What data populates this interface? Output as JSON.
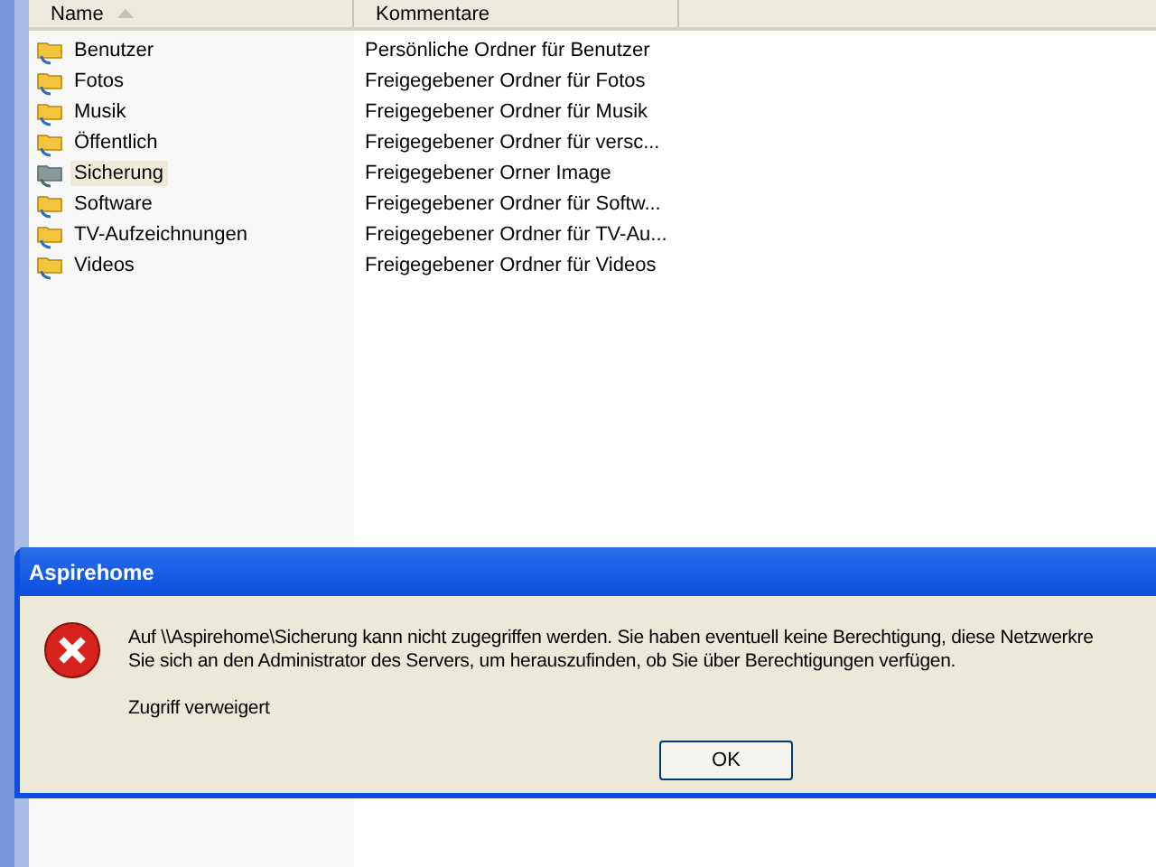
{
  "columns": [
    {
      "label": "Name",
      "sorted": true
    },
    {
      "label": "Kommentare",
      "sorted": false
    }
  ],
  "rows": [
    {
      "name": "Benutzer",
      "comment": "Persönliche Ordner für Benutzer",
      "selected": false,
      "dimmed": false
    },
    {
      "name": "Fotos",
      "comment": "Freigegebener Ordner für Fotos",
      "selected": false,
      "dimmed": false
    },
    {
      "name": "Musik",
      "comment": "Freigegebener Ordner für Musik",
      "selected": false,
      "dimmed": false
    },
    {
      "name": "Öffentlich",
      "comment": "Freigegebener Ordner für versc...",
      "selected": false,
      "dimmed": false
    },
    {
      "name": "Sicherung",
      "comment": "Freigegebener Orner Image",
      "selected": true,
      "dimmed": true
    },
    {
      "name": "Software",
      "comment": "Freigegebener Ordner für Softw...",
      "selected": false,
      "dimmed": false
    },
    {
      "name": "TV-Aufzeichnungen",
      "comment": "Freigegebener Ordner für TV-Au...",
      "selected": false,
      "dimmed": false
    },
    {
      "name": "Videos",
      "comment": "Freigegebener Ordner für Videos",
      "selected": false,
      "dimmed": false
    }
  ],
  "dialog": {
    "title": "Aspirehome",
    "message_lines": [
      "Auf \\\\Aspirehome\\Sicherung kann nicht zugegriffen werden. Sie haben eventuell keine Berechtigung, diese Netzwerkre",
      "Sie sich an den Administrator des Servers, um herauszufinden, ob Sie über Berechtigungen verfügen."
    ],
    "detail": "Zugriff verweigert",
    "button": "OK"
  }
}
